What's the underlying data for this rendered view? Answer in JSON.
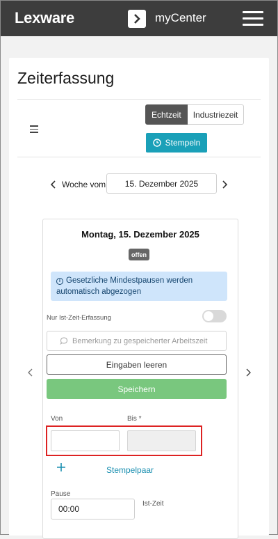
{
  "header": {
    "logo": "Lexware",
    "center_title": "myCenter",
    "icons": {
      "center": "chevron-right-icon",
      "menu": "menu-icon"
    }
  },
  "page": {
    "title": "Zeiterfassung",
    "segments": [
      "Echtzeit",
      "Industriezeit"
    ],
    "active_segment": "Echtzeit",
    "stamp_button": "Stempeln",
    "week_label": "Woche vom",
    "week_value": "15. Dezember 2025"
  },
  "day": {
    "title": "Montag, 15. Dezember 2025",
    "status": "offen",
    "info_text": "Gesetzliche Mindestpausen werden automatisch abgezogen",
    "toggle_label": "Nur Ist-Zeit-Erfassung",
    "toggle_on": false,
    "remark_placeholder": "Bemerkung zu gespeicherter Arbeitszeit",
    "clear_button": "Eingaben leeren",
    "save_button": "Speichern",
    "from_label": "Von",
    "to_label": "Bis *",
    "from_value": "",
    "to_value": "",
    "add_pair_label": "Stempelpaar",
    "pause_label": "Pause",
    "pause_value": "00:00",
    "ist_label": "Ist-Zeit"
  },
  "colors": {
    "topbar": "#3d3d3d",
    "accent": "#1aa0b8",
    "save": "#79c77e",
    "info_bg": "#cfe5fb",
    "highlight": "#dd2222"
  }
}
